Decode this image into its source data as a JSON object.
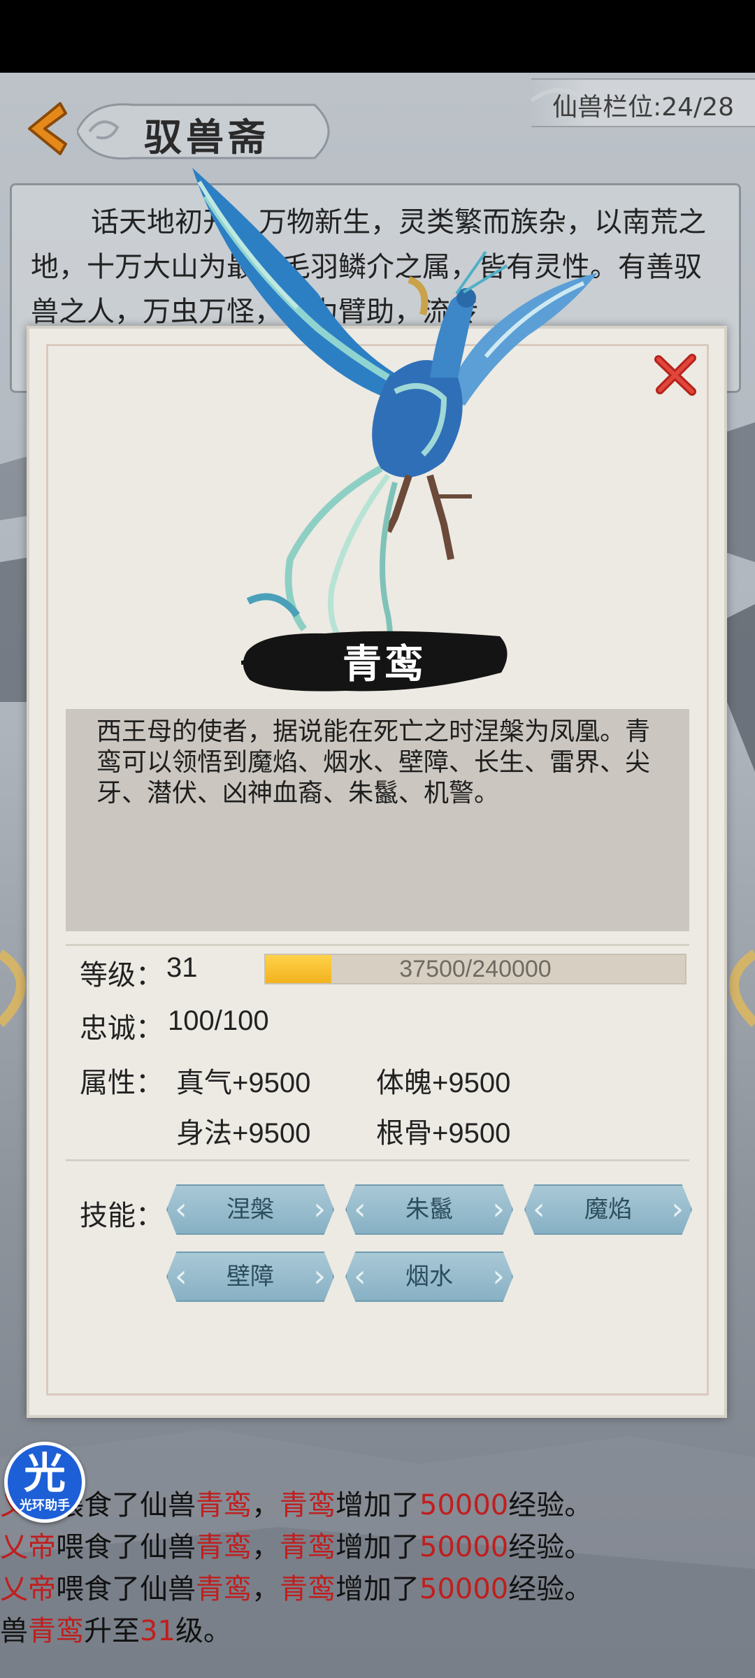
{
  "header": {
    "title": "驭兽斋",
    "slot_label": "仙兽栏位:24/28"
  },
  "intro": {
    "text": "话天地初开，万物新生，灵类繁而族杂，以南荒之地，十万大山为最。毛羽鳞介之属，皆有灵性。有善驭兽之人，万虫万怪，以为臂助，流传"
  },
  "pet": {
    "name": "青鸾",
    "description": "西王母的使者，据说能在死亡之时涅槃为凤凰。青鸾可以领悟到魔焰、烟水、壁障、长生、雷界、尖牙、潜伏、凶神血裔、朱鬣、机警。",
    "level_label": "等级：",
    "level": "31",
    "exp_text": "37500/240000",
    "exp_current": 37500,
    "exp_max": 240000,
    "loyalty_label": "忠诚：",
    "loyalty": "100/100",
    "attr_label": "属性：",
    "attributes": [
      "真气+9500",
      "体魄+9500",
      "身法+9500",
      "根骨+9500"
    ],
    "skills_label": "技能：",
    "skills": [
      "涅槃",
      "朱鬣",
      "魔焰",
      "壁障",
      "烟水"
    ]
  },
  "log": {
    "player": "炎乂帝",
    "fed": "喂食了仙兽",
    "comma": "，",
    "gained": "增加了",
    "amount": "50000",
    "exp_word": "经验。",
    "levelup_prefix": "仙兽",
    "levelup_mid": "升至",
    "levelup_level": "31",
    "levelup_suffix": "级。"
  },
  "helper": {
    "char": "光",
    "label": "光环助手"
  },
  "colors": {
    "highlight": "#c01e1e",
    "skill_button": "#87b1c4",
    "exp_fill": "#f2b21e",
    "helper": "#1d5fd6"
  }
}
